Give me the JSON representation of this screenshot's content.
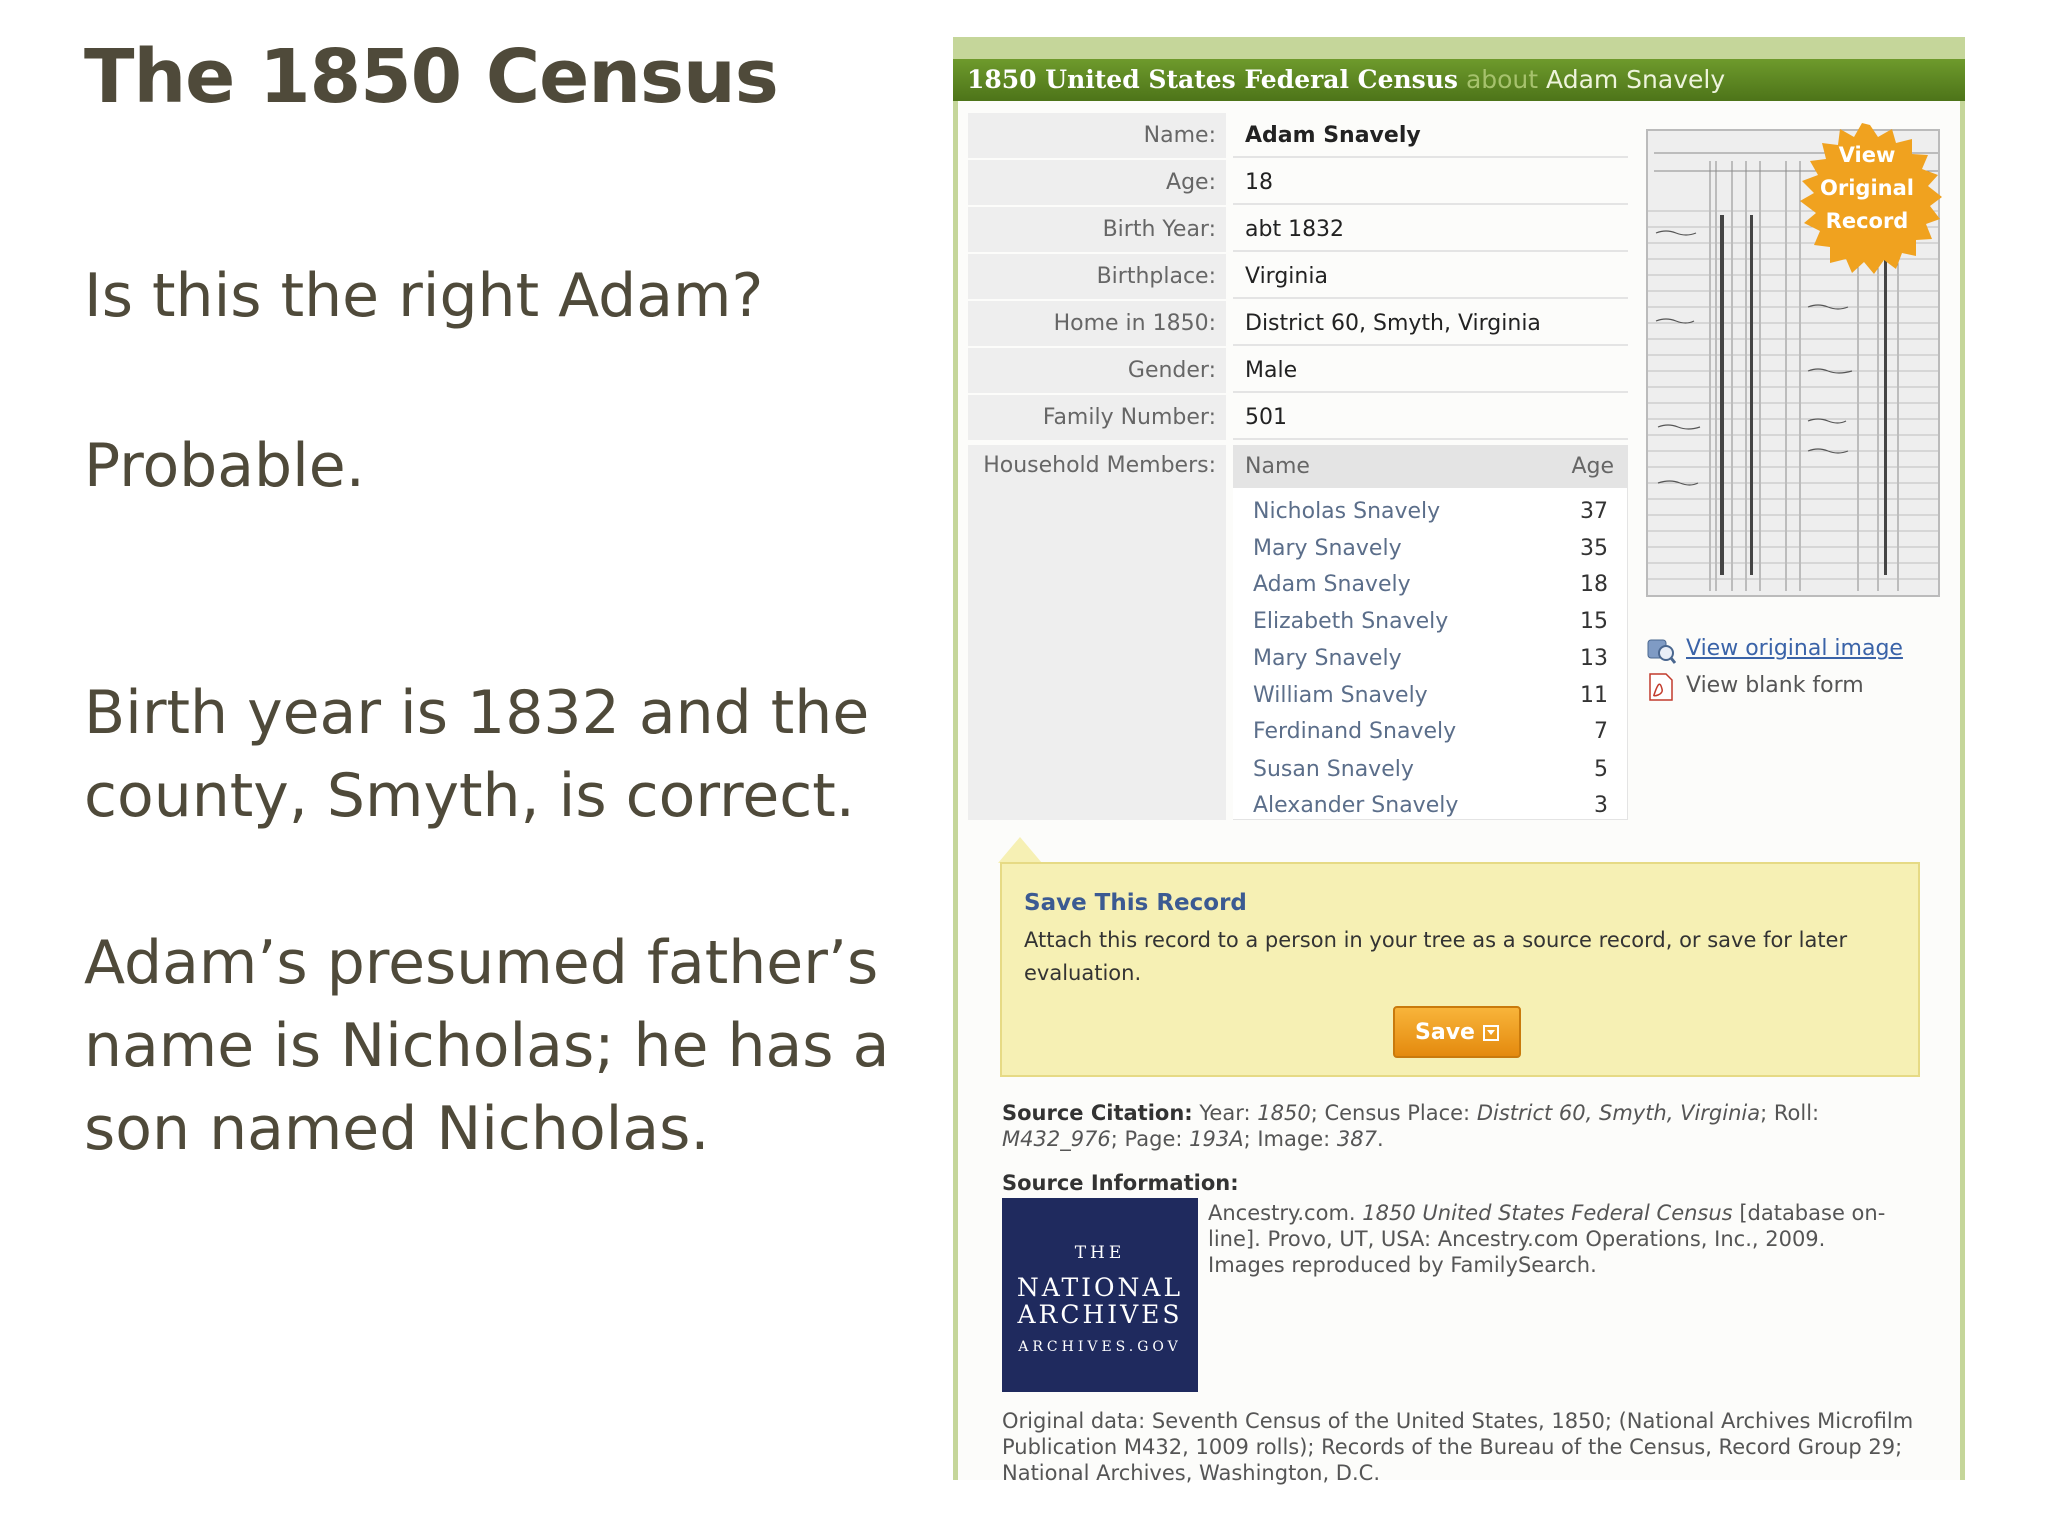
{
  "slide": {
    "title": "The 1850 Census",
    "question": "Is this the right Adam?",
    "answer": "Probable.",
    "birth_note": "Birth year is 1832 and the county, Smyth, is correct.",
    "father_note": "Adam’s presumed father’s name is Nicholas; he has a son named Nicholas."
  },
  "record": {
    "header": {
      "title": "1850 United States Federal Census",
      "about": "about",
      "name": "Adam Snavely"
    },
    "fields": [
      {
        "label": "Name:",
        "value": "Adam Snavely"
      },
      {
        "label": "Age:",
        "value": "18"
      },
      {
        "label": "Birth Year:",
        "value": "abt 1832"
      },
      {
        "label": "Birthplace:",
        "value": "Virginia"
      },
      {
        "label": "Home in 1850:",
        "value": "District 60, Smyth, Virginia"
      },
      {
        "label": "Gender:",
        "value": "Male"
      },
      {
        "label": "Family Number:",
        "value": "501"
      }
    ],
    "household": {
      "label": "Household Members:",
      "col_name": "Name",
      "col_age": "Age",
      "members": [
        {
          "name": "Nicholas Snavely",
          "age": "37"
        },
        {
          "name": "Mary Snavely",
          "age": "35"
        },
        {
          "name": "Adam Snavely",
          "age": "18"
        },
        {
          "name": "Elizabeth Snavely",
          "age": "15"
        },
        {
          "name": "Mary Snavely",
          "age": "13"
        },
        {
          "name": "William Snavely",
          "age": "11"
        },
        {
          "name": "Ferdinand Snavely",
          "age": "7"
        },
        {
          "name": "Susan Snavely",
          "age": "5"
        },
        {
          "name": "Alexander Snavely",
          "age": "3"
        }
      ]
    },
    "badge": {
      "line1": "View",
      "line2": "Original",
      "line3": "Record"
    },
    "links": {
      "view_original": "View original image",
      "view_blank": "View blank form"
    },
    "save": {
      "title": "Save This Record",
      "description": "Attach this record to a person in your tree as a source record, or save for later evaluation.",
      "button": "Save"
    },
    "citation": {
      "label": "Source Citation:",
      "year_label": "Year:",
      "year": "1850",
      "place_label": "; Census Place:",
      "place": "District 60, Smyth, Virginia",
      "roll_label": "; Roll:",
      "roll": "M432_976",
      "page_label": "; Page:",
      "page": "193A",
      "image_label": "; Image:",
      "image": "387",
      "end": "."
    },
    "source_info": {
      "label": "Source Information:",
      "pre": "Ancestry.com.",
      "db_title": "1850 United States Federal Census",
      "post": "[database on-line]. Provo, UT, USA: Ancestry.com Operations, Inc., 2009. Images reproduced by FamilySearch."
    },
    "nara_logo": {
      "the": "THE",
      "national": "NATIONAL",
      "archives": "ARCHIVES",
      "gov": "ARCHIVES.GOV"
    },
    "original_data": "Original data: Seventh Census of the United States, 1850; (National Archives Microfilm Publication M432, 1009 rolls); Records of the Bureau of the Census, Record Group 29; National Archives, Washington, D.C."
  },
  "colors": {
    "header_green": "#5a8221",
    "panel_border": "#c5d69a",
    "save_bg": "#f6f0b4",
    "save_button": "#ef9d20",
    "link_blue": "#3a63a8",
    "slide_text": "#4f4a3a",
    "nara_blue": "#1f2a5e"
  },
  "icons": [
    "view-image-icon",
    "pdf-icon",
    "save-dropdown-icon"
  ]
}
